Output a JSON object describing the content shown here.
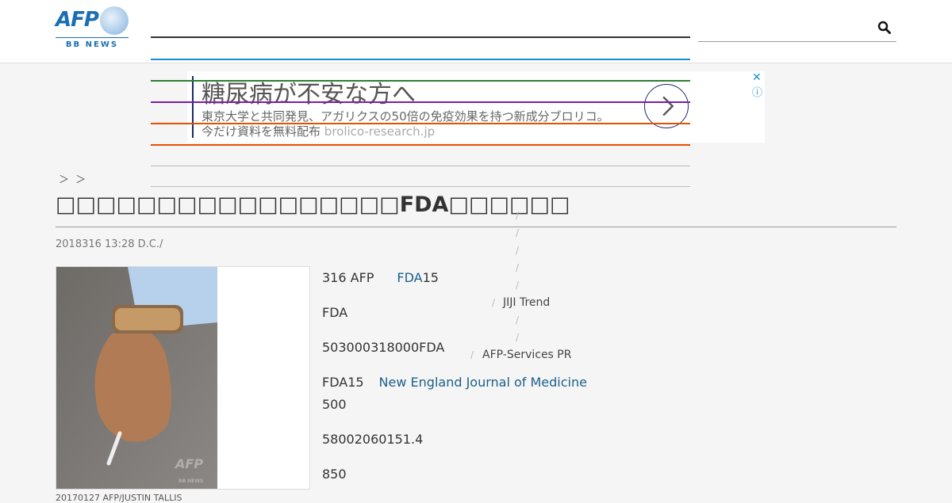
{
  "header": {
    "logo_text": "AFP",
    "logo_sub": "BB NEWS",
    "search": {
      "placeholder": "",
      "icon": "search-icon"
    },
    "nav_line_colors": [
      "#333333",
      "#1a8cd8",
      "#2e7d32",
      "#7b1fa2",
      "#e65100",
      "#e65100",
      "#cccccc",
      "#cccccc"
    ]
  },
  "ad": {
    "title": "糖尿病が不安な方へ",
    "description_line1": "東京大学と共同発見、アガリクスの50倍の免疫効果を持つ新成分ブロリコ。",
    "description_line2": "今だけ資料を無料配布",
    "url": "brolico-research.jp",
    "close_symbol": "✕",
    "info_symbol": "ⓘ"
  },
  "breadcrumb": "＞ ＞",
  "article": {
    "title": "FDA",
    "dateline": "2018316 13:28  D.C./",
    "photo_caption": "20170127 AFP/JUSTIN TALLIS",
    "paragraphs": [
      {
        "text": "316 AFP",
        "link": "FDA",
        "after": "15"
      },
      {
        "text": "FDA"
      },
      {
        "text": "503000318000FDA"
      },
      {
        "text": "FDA15",
        "link": "New England Journal of Medicine"
      },
      {
        "text": "500"
      },
      {
        "text": "58002060151.4"
      },
      {
        "text": "850"
      }
    ]
  },
  "related": {
    "slashes": [
      "/",
      "/",
      "/",
      "/",
      "/",
      "/",
      "/",
      "/",
      "/",
      "/"
    ],
    "items": [
      "JIJI Trend",
      "AFP-Services PR"
    ]
  }
}
